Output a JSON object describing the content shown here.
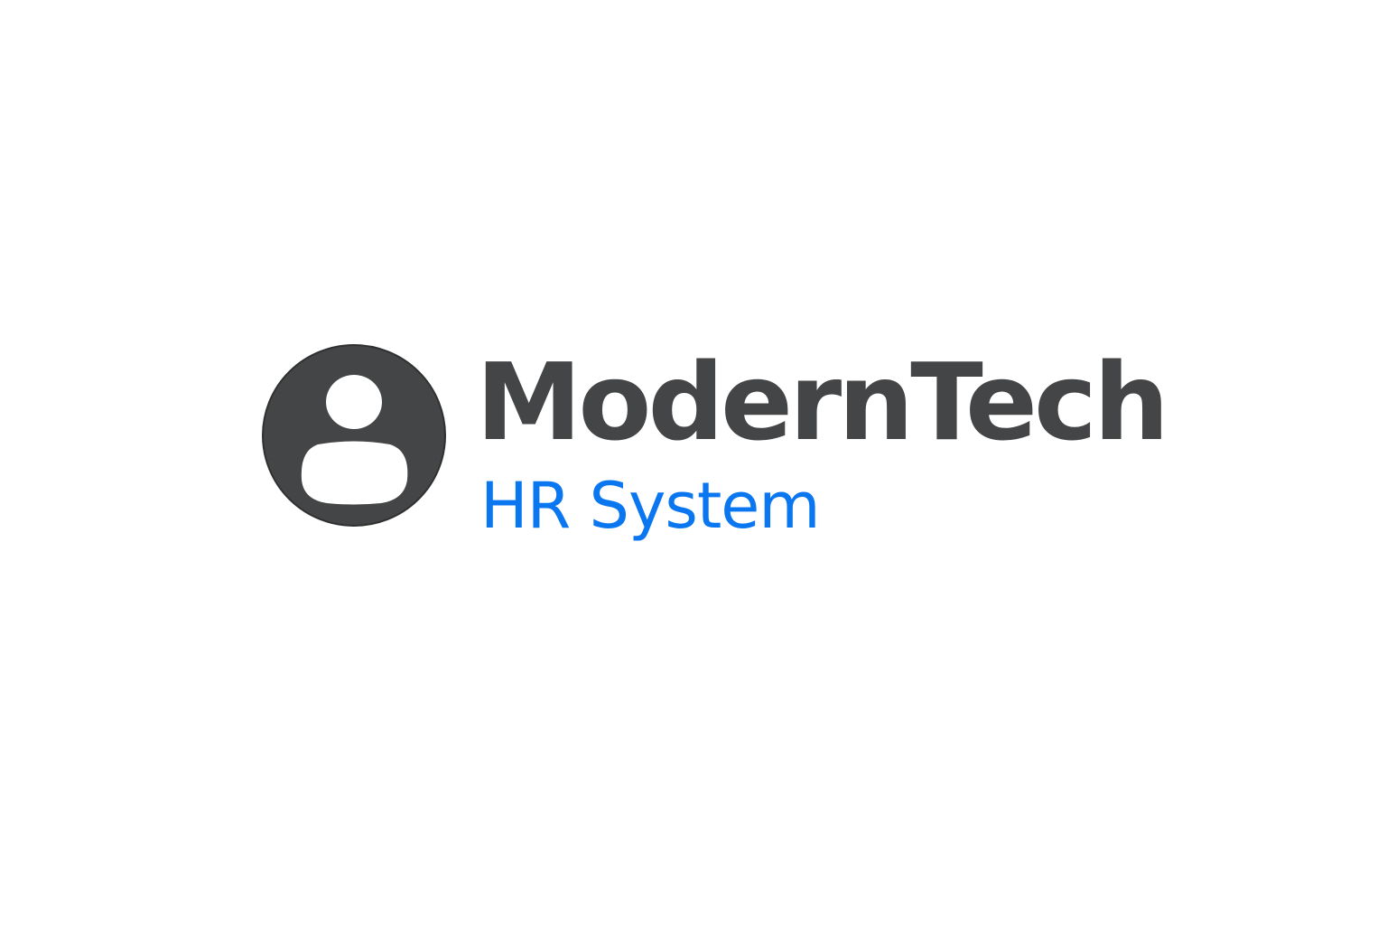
{
  "logo": {
    "icon": "user-avatar-icon",
    "brand_name": "ModernTech",
    "product_name": "HR System"
  },
  "colors": {
    "background": "#ffffff",
    "icon": "#444546",
    "brand_text": "#444546",
    "product_text": "#0a77f0"
  }
}
